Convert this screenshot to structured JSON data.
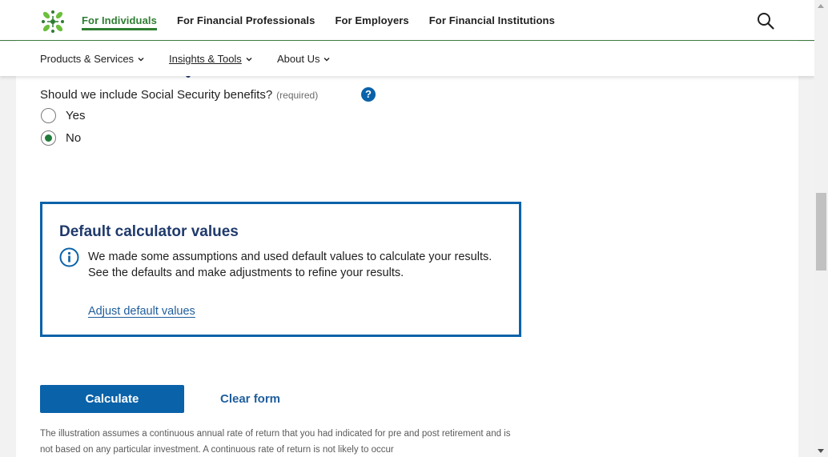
{
  "header": {
    "nav": [
      {
        "label": "For Individuals",
        "active": true
      },
      {
        "label": "For Financial Professionals",
        "active": false
      },
      {
        "label": "For Employers",
        "active": false
      },
      {
        "label": "For Financial Institutions",
        "active": false
      }
    ],
    "search_icon": "search-icon",
    "logo_icon": "leaf-cluster-logo",
    "brand_color": "#2f7d32"
  },
  "subnav": {
    "items": [
      {
        "label": "Products & Services"
      },
      {
        "label": "Insights & Tools"
      },
      {
        "label": "About Us"
      }
    ]
  },
  "question": {
    "label": "Should we include Social Security benefits?",
    "required": "(required)",
    "help": "?",
    "options": [
      {
        "label": "Yes",
        "checked": false
      },
      {
        "label": "No",
        "checked": true
      }
    ]
  },
  "defaults_box": {
    "title": "Default calculator values",
    "body": "We made some assumptions and used default values to calculate your results. See the defaults and make adjustments to refine your results.",
    "link": "Adjust default values",
    "accent": "#0a62a9"
  },
  "actions": {
    "calculate": "Calculate",
    "clear": "Clear form"
  },
  "disclaimer": "The illustration assumes a continuous annual rate of return that you had indicated for pre and post retirement and is not based on any particular investment. A continuous rate of return is not likely to occur"
}
